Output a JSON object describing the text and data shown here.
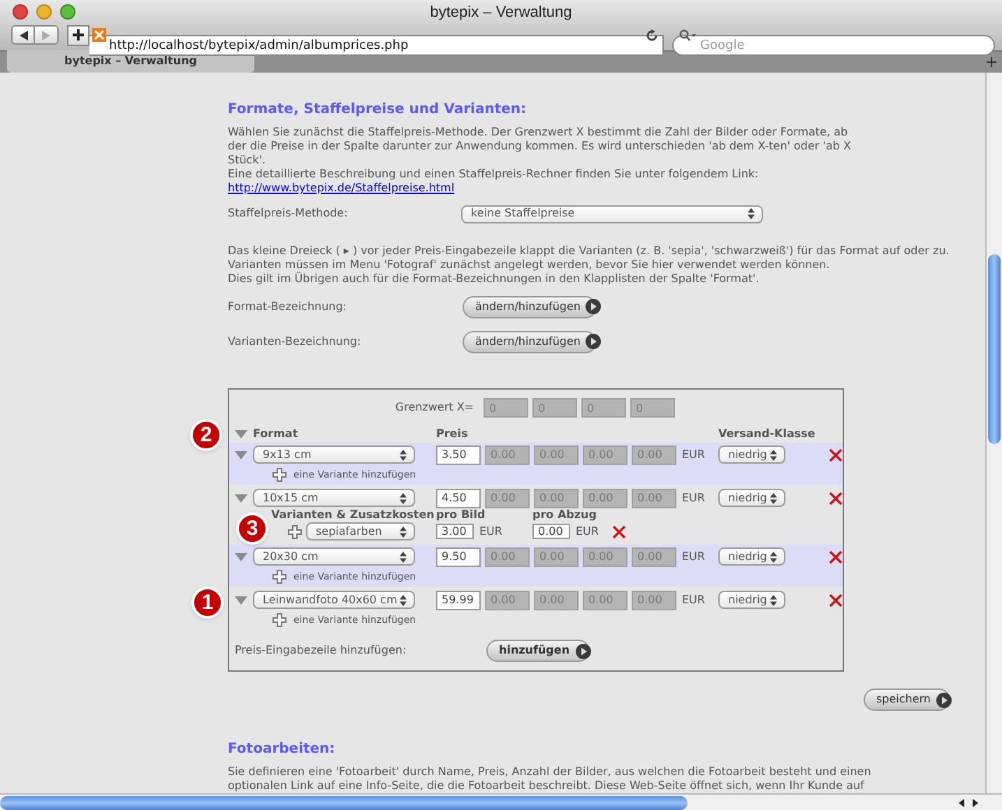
{
  "window": {
    "title": "bytepix – Verwaltung"
  },
  "toolbar": {
    "url": "http://localhost/bytepix/admin/albumprices.php",
    "search": {
      "placeholder": "Google"
    }
  },
  "tabs": [
    {
      "label": "bytepix – Verwaltung",
      "selected": true
    }
  ],
  "section": {
    "title": "Formate, Staffelpreise und Varianten:",
    "intro": [
      "Wählen Sie zunächst die Staffelpreis-Methode. Der Grenzwert X bestimmt die Zahl der Bilder oder Formate, ab der die Preise in der Spalte darunter zur Anwendung kommen. Es wird unterschieden 'ab dem X-ten' oder 'ab X Stück'.",
      "Eine detaillierte Beschreibung und einen Staffelpreis-Rechner finden Sie unter folgendem Link:"
    ],
    "link": "http://www.bytepix.de/Staffelpreise.html",
    "method_label": "Staffelpreis-Methode:",
    "method_value": "keine Staffelpreise",
    "notes": [
      "Das kleine Dreieck ( ▸ ) vor jeder Preis-Eingabezeile klappt die Varianten (z. B. 'sepia', 'schwarzweiß') für das Format auf oder zu.",
      "Varianten müssen im Menu 'Fotograf' zunächst angelegt werden, bevor Sie hier verwendet werden können.",
      "Dies gilt im Übrigen auch für die Format-Bezeichnungen in den Klapplisten der Spalte 'Format'."
    ],
    "settings": [
      {
        "label": "Format-Bezeichnung:",
        "button": "ändern/hinzufügen"
      },
      {
        "label": "Varianten-Bezeichnung:",
        "button": "ändern/hinzufügen"
      }
    ]
  },
  "price_table": {
    "threshold_label": "Grenzwert X=",
    "thresholds": [
      "0",
      "0",
      "0",
      "0"
    ],
    "tiers_disabled": true,
    "columns": {
      "format": "Format",
      "price": "Preis",
      "shipping": "Versand-Klasse"
    },
    "rows": [
      {
        "format": "9x13 cm",
        "price": "3.50",
        "tiers": [
          "0.00",
          "0.00",
          "0.00",
          "0.00"
        ],
        "currency": "EUR",
        "shipping": "niedrig",
        "shaded": true,
        "add_variant": "eine Variante hinzufügen"
      },
      {
        "format": "10x15 cm",
        "price": "4.50",
        "tiers": [
          "0.00",
          "0.00",
          "0.00",
          "0.00"
        ],
        "currency": "EUR",
        "shipping": "niedrig",
        "shaded": false,
        "variants": {
          "heading": "Varianten & Zusatzkosten",
          "per_image": "pro Bild",
          "per_print": "pro Abzug",
          "items": [
            {
              "name": "sepiafarben",
              "per_image": "3.00",
              "per_image_currency": "EUR",
              "per_print": "0.00",
              "per_print_currency": "EUR"
            }
          ]
        }
      },
      {
        "format": "20x30 cm",
        "price": "9.50",
        "tiers": [
          "0.00",
          "0.00",
          "0.00",
          "0.00"
        ],
        "currency": "EUR",
        "shipping": "niedrig",
        "shaded": true,
        "add_variant": "eine Variante hinzufügen"
      },
      {
        "format": "Leinwandfoto 40x60 cm",
        "price": "59.99",
        "tiers": [
          "0.00",
          "0.00",
          "0.00",
          "0.00"
        ],
        "currency": "EUR",
        "shipping": "niedrig",
        "shaded": false,
        "add_variant": "eine Variante hinzufügen"
      }
    ],
    "add_row_label": "Preis-Eingabezeile hinzufügen:",
    "add_row_button": "hinzufügen"
  },
  "annotations": [
    {
      "label": "2"
    },
    {
      "label": "3"
    },
    {
      "label": "1"
    }
  ],
  "save_button": "speichern",
  "section2": {
    "title": "Fotoarbeiten:",
    "text": "Sie definieren eine 'Fotoarbeit' durch Name, Preis, Anzahl der Bilder, aus welchen die Fotoarbeit besteht und einen optionalen Link auf eine Info-Seite, die die Fotoarbeit beschreibt. Diese Web-Seite öffnet sich, wenn Ihr Kunde auf"
  }
}
